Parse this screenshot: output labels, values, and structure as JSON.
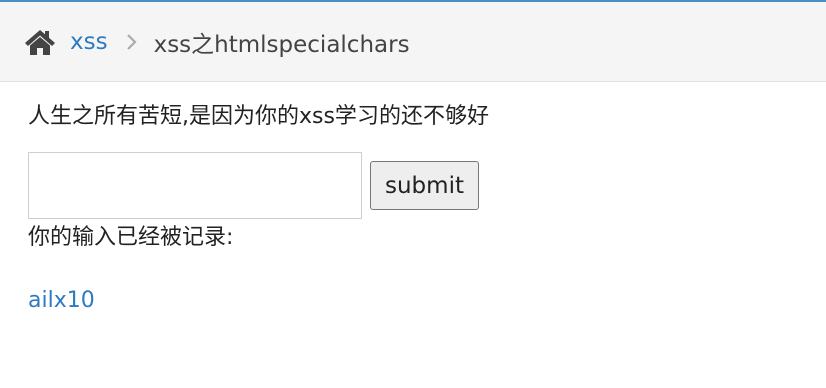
{
  "header": {
    "home_icon": "home-icon",
    "crumb_link": "xss",
    "separator_icon": "chevron-right-icon",
    "current": "xss之htmlspecialchars"
  },
  "main": {
    "intro": "人生之所有苦短,是因为你的xss学习的还不够好",
    "input": {
      "value": "",
      "placeholder": ""
    },
    "submit_label": "submit",
    "record_label": "你的输入已经被记录:",
    "record_value": "ailx10"
  },
  "colors": {
    "accent": "#2e7bbf",
    "top_line": "#4a8fc8",
    "breadcrumb_bg": "#f5f5f5"
  }
}
